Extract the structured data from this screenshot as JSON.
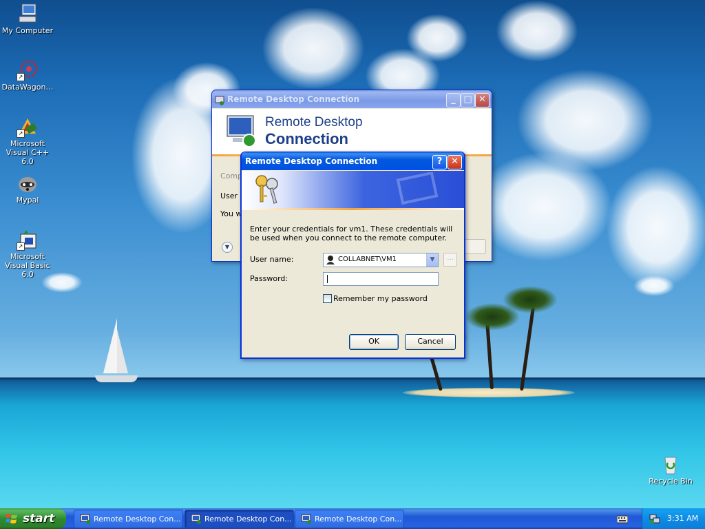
{
  "desktop": {
    "icons": [
      {
        "label": "My Computer"
      },
      {
        "label": "DataWagon…"
      },
      {
        "label": "Microsoft Visual C++ 6.0"
      },
      {
        "label": "Mypal"
      },
      {
        "label": "Microsoft Visual Basic 6.0"
      },
      {
        "label": "Recycle Bin"
      }
    ]
  },
  "back_window": {
    "title": "Remote Desktop Connection",
    "banner_line1": "Remote Desktop",
    "banner_line2": "Connection",
    "partial_lines": [
      "Comp",
      "User n",
      "You w"
    ]
  },
  "dialog": {
    "title": "Remote Desktop Connection",
    "message": "Enter your credentials for vm1. These credentials will be used when you connect to the remote computer.",
    "username_label": "User name:",
    "username_value": "COLLABNET\\VM1",
    "browse_label": "...",
    "password_label": "Password:",
    "password_value": "",
    "remember_label": "Remember my password",
    "remember_checked": false,
    "ok_label": "OK",
    "cancel_label": "Cancel",
    "help_label": "?",
    "close_label": "✕"
  },
  "taskbar": {
    "start_label": "start",
    "tasks": [
      {
        "label": "Remote Desktop Con..."
      },
      {
        "label": "Remote Desktop Con..."
      },
      {
        "label": "Remote Desktop Con..."
      }
    ],
    "clock": "3:31 AM"
  },
  "colors": {
    "title_active": "#0053e1",
    "start_green": "#2e8b2e",
    "dialog_face": "#ece9d8"
  }
}
